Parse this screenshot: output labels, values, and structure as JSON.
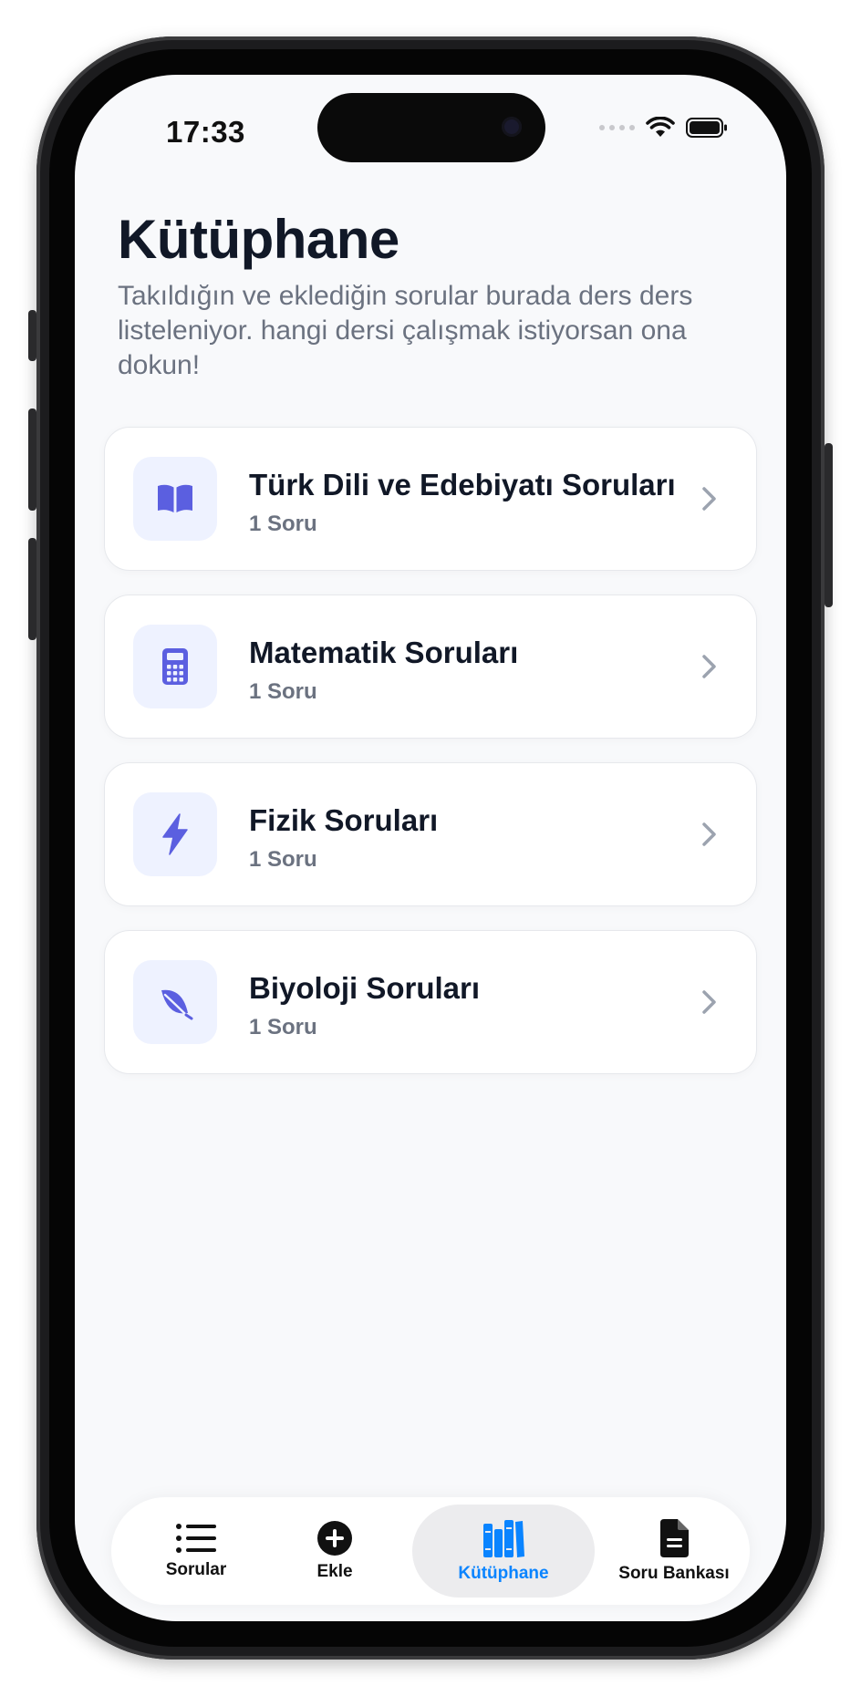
{
  "status_bar": {
    "time": "17:33"
  },
  "page": {
    "title": "Kütüphane",
    "subtitle": "Takıldığın ve eklediğin sorular burada ders ders listeleniyor. hangi dersi çalışmak istiyorsan ona dokun!"
  },
  "subjects": [
    {
      "title": "Türk Dili ve Edebiyatı Soruları",
      "count": "1 Soru",
      "icon": "book-icon"
    },
    {
      "title": "Matematik Soruları",
      "count": "1 Soru",
      "icon": "calculator-icon"
    },
    {
      "title": "Fizik Soruları",
      "count": "1 Soru",
      "icon": "bolt-icon"
    },
    {
      "title": "Biyoloji Soruları",
      "count": "1 Soru",
      "icon": "leaf-icon"
    }
  ],
  "tab_bar": {
    "tabs": [
      {
        "label": "Sorular",
        "icon": "list-icon",
        "active": false
      },
      {
        "label": "Ekle",
        "icon": "plus-circle-icon",
        "active": false
      },
      {
        "label": "Kütüphane",
        "icon": "books-icon",
        "active": true
      },
      {
        "label": "Soru Bankası",
        "icon": "document-icon",
        "active": false
      }
    ]
  },
  "colors": {
    "accent": "#0a84ff",
    "icon_color": "#5b5fe0",
    "icon_bg": "#eef2ff",
    "title_text": "#111827",
    "muted_text": "#6b7280",
    "background": "#f8f9fb"
  }
}
